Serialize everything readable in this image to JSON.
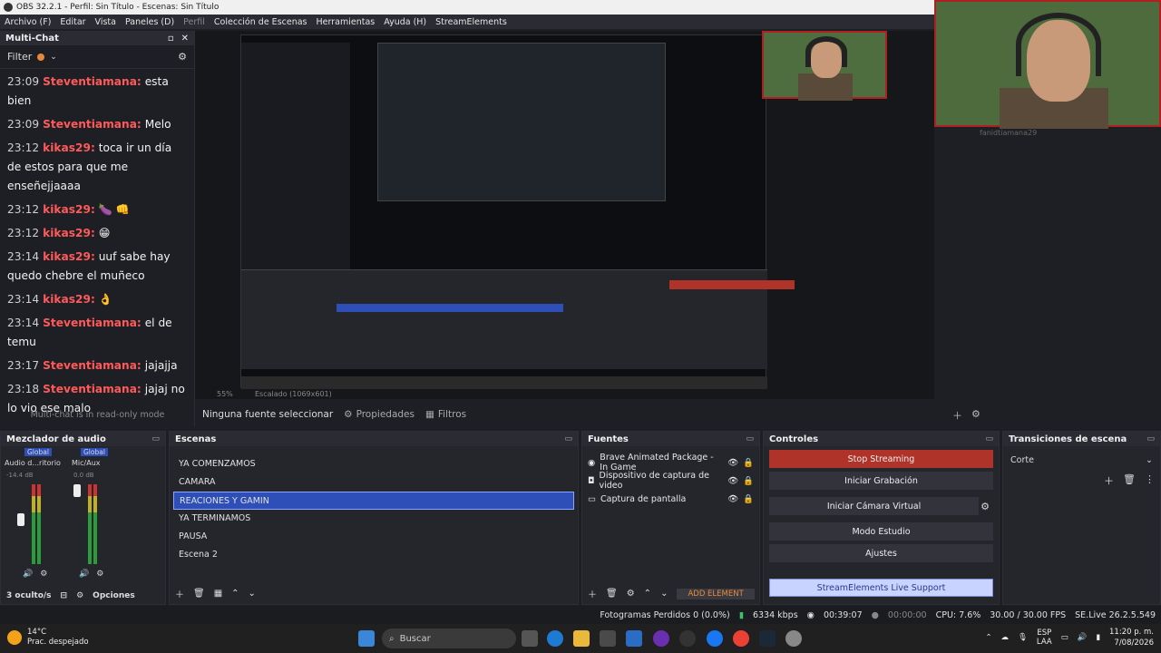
{
  "window_title": "OBS 32.2.1 - Perfil: Sin Título - Escenas: Sin Título",
  "menu": [
    "Archivo (F)",
    "Editar",
    "Vista",
    "Paneles (D)",
    "Perfil",
    "Colección de Escenas",
    "Herramientas",
    "Ayuda (H)",
    "StreamElements"
  ],
  "chat": {
    "title": "Multi-Chat",
    "filter_label": "Filter",
    "messages": [
      {
        "time": "23:09",
        "user": "Steventiamana:",
        "text": "esta bien"
      },
      {
        "time": "23:09",
        "user": "Steventiamana:",
        "text": "Melo"
      },
      {
        "time": "23:12",
        "user": "kikas29:",
        "text": "toca ir un día de estos para que me enseñejjaaaa"
      },
      {
        "time": "23:12",
        "user": "kikas29:",
        "text": "🍆 👊"
      },
      {
        "time": "23:12",
        "user": "kikas29:",
        "text": "😁"
      },
      {
        "time": "23:14",
        "user": "kikas29:",
        "text": "uuf sabe hay quedo chebre el muñeco"
      },
      {
        "time": "23:14",
        "user": "kikas29:",
        "text": "👌"
      },
      {
        "time": "23:14",
        "user": "Steventiamana:",
        "text": "el de temu"
      },
      {
        "time": "23:17",
        "user": "Steventiamana:",
        "text": "jajajja"
      },
      {
        "time": "23:18",
        "user": "Steventiamana:",
        "text": "jajaj no lo vio ese malo"
      }
    ],
    "footer": "Multi-chat is in read-only mode"
  },
  "preview": {
    "zoom": "55%",
    "resolution": "Escalado (1069x601)"
  },
  "cam_label": "fanidtiamana29",
  "source_bar": {
    "no_source": "Ninguna fuente seleccionar",
    "properties": "Propiedades",
    "filters": "Filtros"
  },
  "mixer": {
    "title": "Mezclador de audio",
    "channels": [
      {
        "badge": "Global",
        "name": "Audio d...ritorio",
        "db": "-14.4 dB"
      },
      {
        "badge": "Global",
        "name": "Mic/Aux",
        "db": "0.0 dB"
      }
    ],
    "hidden": "3 oculto/s",
    "options": "Opciones"
  },
  "scenes": {
    "title": "Escenas",
    "items": [
      "YA COMENZAMOS",
      "CAMARA",
      "REACIONES Y GAMIN",
      "YA TERMINAMOS",
      "PAUSA",
      "Escena 2"
    ],
    "selected_index": 2
  },
  "sources": {
    "title": "Fuentes",
    "items": [
      "Brave Animated Package - In Game",
      "Dispositivo de captura de video",
      "Captura de pantalla"
    ],
    "add_element": "ADD ELEMENT"
  },
  "controls": {
    "title": "Controles",
    "stop": "Stop Streaming",
    "record": "Iniciar Grabación",
    "vcam": "Iniciar Cámara Virtual",
    "studio": "Modo Estudio",
    "settings": "Ajustes",
    "se_support": "StreamElements Live Support"
  },
  "transitions": {
    "title": "Transiciones de escena",
    "value": "Corte"
  },
  "status": {
    "dropped": "Fotogramas Perdidos 0 (0.0%)",
    "kbps": "6334 kbps",
    "live_time": "00:39:07",
    "rec_time": "00:00:00",
    "cpu": "CPU: 7.6%",
    "fps": "30.00 / 30.00 FPS",
    "se_version": "SE.Live 26.2.5.549"
  },
  "taskbar": {
    "temp": "14°C",
    "weather": "Prac. despejado",
    "search": "Buscar",
    "lang": "ESP",
    "lang2": "LAA",
    "time": "11:20 p. m.",
    "date": "7/08/2026"
  },
  "colors": {
    "accent_selected": "#2f4fb8",
    "stop_red": "#b0332a",
    "chat_user": "#ff5a5a"
  }
}
